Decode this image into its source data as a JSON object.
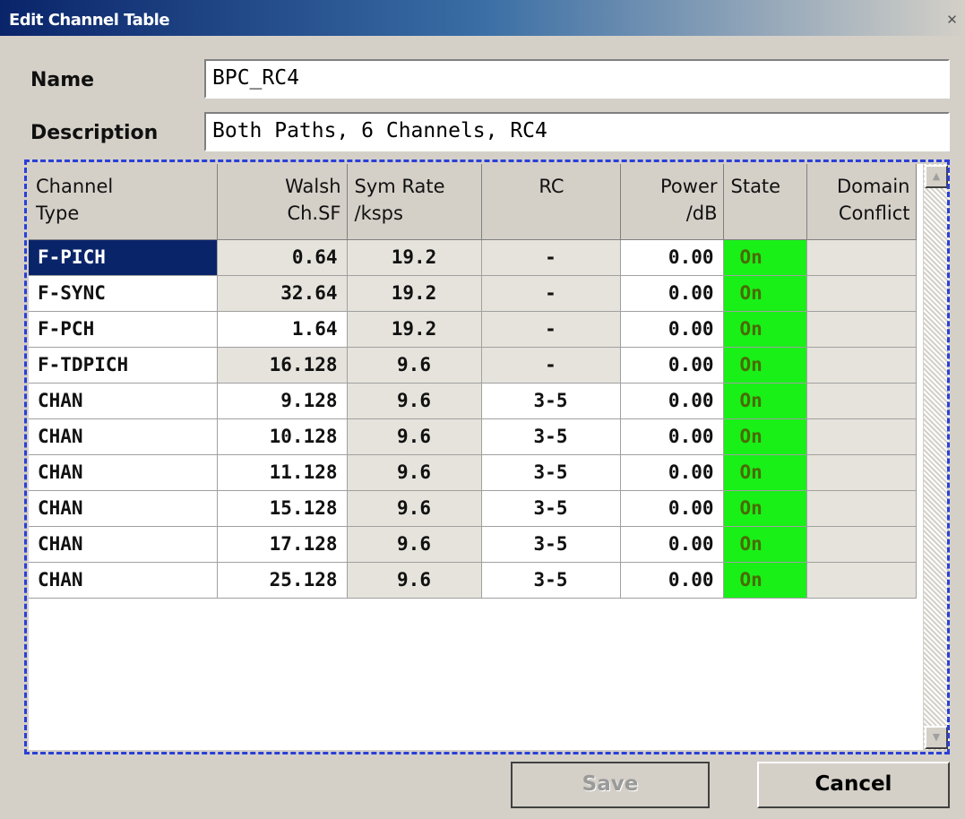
{
  "window": {
    "title": "Edit Channel Table",
    "close_symbol": "✕"
  },
  "form": {
    "name_label": "Name",
    "name_value": "BPC_RC4",
    "description_label": "Description",
    "description_value": "Both Paths, 6 Channels, RC4"
  },
  "table": {
    "headers": [
      [
        "Channel",
        "Type"
      ],
      [
        "Walsh",
        "Ch.SF"
      ],
      [
        "Sym Rate",
        "/ksps"
      ],
      [
        "RC",
        ""
      ],
      [
        "Power",
        "/dB"
      ],
      [
        "State",
        ""
      ],
      [
        "Domain",
        "Conflict"
      ]
    ],
    "rows": [
      {
        "type": "F-PICH",
        "walsh": "0.64",
        "sym_rate": "19.2",
        "rc": "-",
        "power": "0.00",
        "state": "On",
        "conflict": ""
      },
      {
        "type": "F-SYNC",
        "walsh": "32.64",
        "sym_rate": "19.2",
        "rc": "-",
        "power": "0.00",
        "state": "On",
        "conflict": ""
      },
      {
        "type": "F-PCH",
        "walsh": "1.64",
        "sym_rate": "19.2",
        "rc": "-",
        "power": "0.00",
        "state": "On",
        "conflict": ""
      },
      {
        "type": "F-TDPICH",
        "walsh": "16.128",
        "sym_rate": "9.6",
        "rc": "-",
        "power": "0.00",
        "state": "On",
        "conflict": ""
      },
      {
        "type": "CHAN",
        "walsh": "9.128",
        "sym_rate": "9.6",
        "rc": "3-5",
        "power": "0.00",
        "state": "On",
        "conflict": ""
      },
      {
        "type": "CHAN",
        "walsh": "10.128",
        "sym_rate": "9.6",
        "rc": "3-5",
        "power": "0.00",
        "state": "On",
        "conflict": ""
      },
      {
        "type": "CHAN",
        "walsh": "11.128",
        "sym_rate": "9.6",
        "rc": "3-5",
        "power": "0.00",
        "state": "On",
        "conflict": ""
      },
      {
        "type": "CHAN",
        "walsh": "15.128",
        "sym_rate": "9.6",
        "rc": "3-5",
        "power": "0.00",
        "state": "On",
        "conflict": ""
      },
      {
        "type": "CHAN",
        "walsh": "17.128",
        "sym_rate": "9.6",
        "rc": "3-5",
        "power": "0.00",
        "state": "On",
        "conflict": ""
      },
      {
        "type": "CHAN",
        "walsh": "25.128",
        "sym_rate": "9.6",
        "rc": "3-5",
        "power": "0.00",
        "state": "On",
        "conflict": ""
      }
    ]
  },
  "buttons": {
    "save_label": "Save",
    "cancel_label": "Cancel"
  },
  "colors": {
    "title_bar": "#0a246a",
    "selection": "#0a246a",
    "state_on": "#18f018",
    "focus_frame": "#2a3fd8"
  },
  "icons": {
    "close": "close-icon",
    "scroll_up": "scroll-up-arrow-icon",
    "scroll_down": "scroll-down-arrow-icon"
  }
}
